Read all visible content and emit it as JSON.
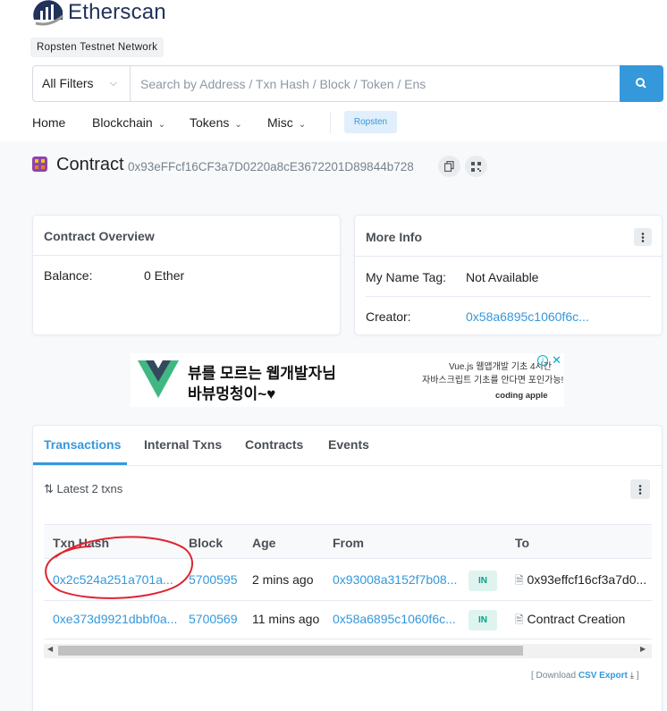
{
  "brand": {
    "name": "Etherscan",
    "network_badge": "Ropsten Testnet Network"
  },
  "search": {
    "filter_label": "All Filters",
    "placeholder": "Search by Address / Txn Hash / Block / Token / Ens"
  },
  "nav": {
    "home": "Home",
    "blockchain": "Blockchain",
    "tokens": "Tokens",
    "misc": "Misc",
    "network_pill": "Ropsten"
  },
  "contract": {
    "title": "Contract",
    "address": "0x93eFFcf16CF3a7D0220a8cE3672201D89844b728"
  },
  "overview": {
    "title": "Contract Overview",
    "balance_label": "Balance:",
    "balance_value": "0 Ether"
  },
  "more_info": {
    "title": "More Info",
    "name_tag_label": "My Name Tag:",
    "name_tag_value": "Not Available",
    "creator_label": "Creator:",
    "creator_value": "0x58a6895c1060f6c..."
  },
  "ad": {
    "line1": "뷰를 모르는 웹개발자님",
    "line2": "바뷰멍청이~♥",
    "right1": "Vue.js 웹앱개발 기초 4시간",
    "right2": "자바스크립트 기초를 안다면 포인가능!",
    "brand": "coding apple"
  },
  "tabs": [
    "Transactions",
    "Internal Txns",
    "Contracts",
    "Events"
  ],
  "txns": {
    "summary": "Latest 2 txns",
    "columns": [
      "Txn Hash",
      "Block",
      "Age",
      "From",
      "",
      "To"
    ],
    "rows": [
      {
        "hash": "0x2c524a251a701a...",
        "block": "5700595",
        "age": "2 mins ago",
        "from": "0x93008a3152f7b08...",
        "dir": "IN",
        "to": "0x93effcf16cf3a7d0..."
      },
      {
        "hash": "0xe373d9921dbbf0a...",
        "block": "5700569",
        "age": "11 mins ago",
        "from": "0x58a6895c1060f6c...",
        "dir": "IN",
        "to": "Contract Creation"
      }
    ],
    "download_prefix": "[ Download",
    "download_link": "CSV Export",
    "download_suffix": "]"
  },
  "colors": {
    "accent": "#3498db",
    "in_badge": "#00a186",
    "annotation": "#e0232f"
  }
}
